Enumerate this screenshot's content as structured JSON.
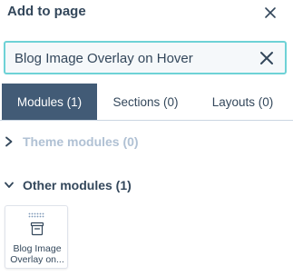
{
  "header": {
    "title": "Add to page",
    "close_icon": "close-icon"
  },
  "search": {
    "value": "Blog Image Overlay on Hover",
    "clear_icon": "clear-icon"
  },
  "tabs": [
    {
      "label": "Modules (1)",
      "active": true
    },
    {
      "label": "Sections (0)",
      "active": false
    },
    {
      "label": "Layouts (0)",
      "active": false
    }
  ],
  "groups": {
    "theme": {
      "label": "Theme modules (0)",
      "expanded": false,
      "icon": "chevron-right-icon"
    },
    "other": {
      "label": "Other modules (1)",
      "expanded": true,
      "icon": "chevron-down-icon"
    }
  },
  "modules": [
    {
      "label": "Blog Image Overlay on...",
      "icon": "module-icon"
    }
  ],
  "colors": {
    "text": "#33475b",
    "active_tab": "#425b76",
    "muted": "#b0c1d4",
    "focus_border": "#6ed2d6"
  }
}
